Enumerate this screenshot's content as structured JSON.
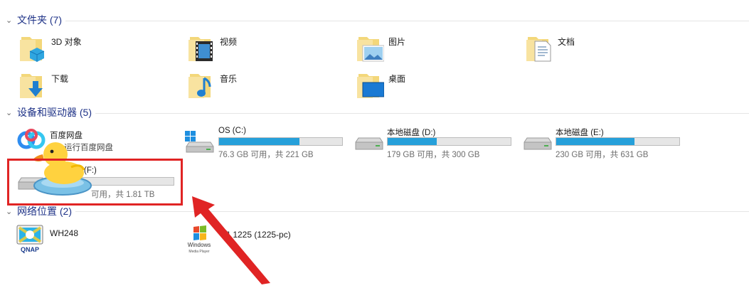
{
  "groups": {
    "folders": {
      "label": "文件夹 (7)"
    },
    "devices": {
      "label": "设备和驱动器 (5)"
    },
    "network": {
      "label": "网络位置 (2)"
    }
  },
  "folders": [
    {
      "label": "3D 对象",
      "icon": "3d-objects-folder-icon"
    },
    {
      "label": "视频",
      "icon": "videos-folder-icon"
    },
    {
      "label": "图片",
      "icon": "pictures-folder-icon"
    },
    {
      "label": "文档",
      "icon": "documents-folder-icon"
    },
    {
      "label": "下载",
      "icon": "downloads-folder-icon"
    },
    {
      "label": "音乐",
      "icon": "music-folder-icon"
    },
    {
      "label": "桌面",
      "icon": "desktop-folder-icon"
    }
  ],
  "devices": {
    "baidu": {
      "name": "百度网盘",
      "sub": "运行百度网盘"
    },
    "drives": [
      {
        "name": "OS (C:)",
        "free": "76.3 GB 可用，共 221 GB",
        "used_fraction": 0.655
      },
      {
        "name": "本地磁盘 (D:)",
        "free": "179 GB 可用，共 300 GB",
        "used_fraction": 0.4
      },
      {
        "name": "本地磁盘 (E:)",
        "free": "230 GB 可用，共 631 GB",
        "used_fraction": 0.635
      },
      {
        "name": "(F:)",
        "free": "可用，共 1.81 TB",
        "used_fraction": 0.0
      }
    ]
  },
  "network": [
    {
      "name": "WH248",
      "icon": "qnap-icon",
      "logo_text": "QNAP"
    },
    {
      "name": "户 1225 (1225-pc)",
      "icon": "windows-media-player-icon",
      "logo_text": "Windows Media Player"
    }
  ],
  "colors": {
    "group_header": "#1e3287",
    "drive_fill": "#26a0da",
    "highlight_box": "#e02424",
    "arrow": "#e02424"
  }
}
